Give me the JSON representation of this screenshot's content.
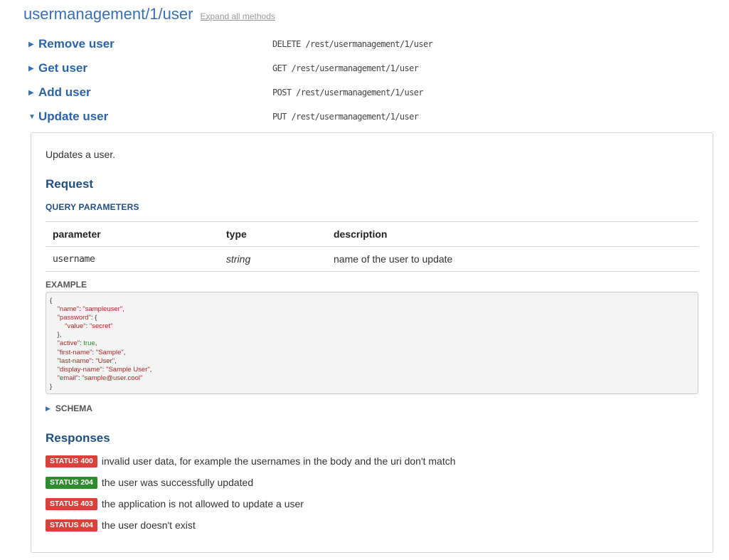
{
  "resource": {
    "title": "usermanagement/1/user",
    "expand_label": "Expand all methods"
  },
  "methods": [
    {
      "name": "Remove user",
      "endpoint": "DELETE /rest/usermanagement/1/user",
      "expanded": false
    },
    {
      "name": "Get user",
      "endpoint": "GET /rest/usermanagement/1/user",
      "expanded": false
    },
    {
      "name": "Add user",
      "endpoint": "POST /rest/usermanagement/1/user",
      "expanded": false
    },
    {
      "name": "Update user",
      "endpoint": "PUT /rest/usermanagement/1/user",
      "expanded": true
    }
  ],
  "detail": {
    "description": "Updates a user.",
    "request_heading": "Request",
    "query_params_heading": "QUERY PARAMETERS",
    "table": {
      "headers": [
        "parameter",
        "type",
        "description"
      ],
      "rows": [
        [
          "username",
          "string",
          "name of the user to update"
        ]
      ]
    },
    "example_heading": "EXAMPLE",
    "example_lines": [
      "{",
      "    \"name\": \"sampleuser\",",
      "    \"password\": {",
      "        \"value\": \"secret\"",
      "    },",
      "    \"active\": true,",
      "    \"first-name\": \"Sample\",",
      "    \"last-name\": \"User\",",
      "    \"display-name\": \"Sample User\",",
      "    \"email\": \"sample@user.cool\"",
      "}"
    ],
    "schema_label": "SCHEMA",
    "responses_heading": "Responses",
    "responses": [
      {
        "status": "STATUS 400",
        "text": "invalid user data, for example the usernames in the body and the uri don't match",
        "color": "#d9413a"
      },
      {
        "status": "STATUS 204",
        "text": "the user was successfully updated",
        "color": "#2e8b2e"
      },
      {
        "status": "STATUS 403",
        "text": "the application is not allowed to update a user",
        "color": "#d9413a"
      },
      {
        "status": "STATUS 404",
        "text": "the user doesn't exist",
        "color": "#d9413a"
      }
    ]
  },
  "colors": {
    "link_blue": "#2b63a8",
    "heading_blue": "#1f4f82",
    "error_red": "#d9413a",
    "success_green": "#2e8b2e"
  }
}
